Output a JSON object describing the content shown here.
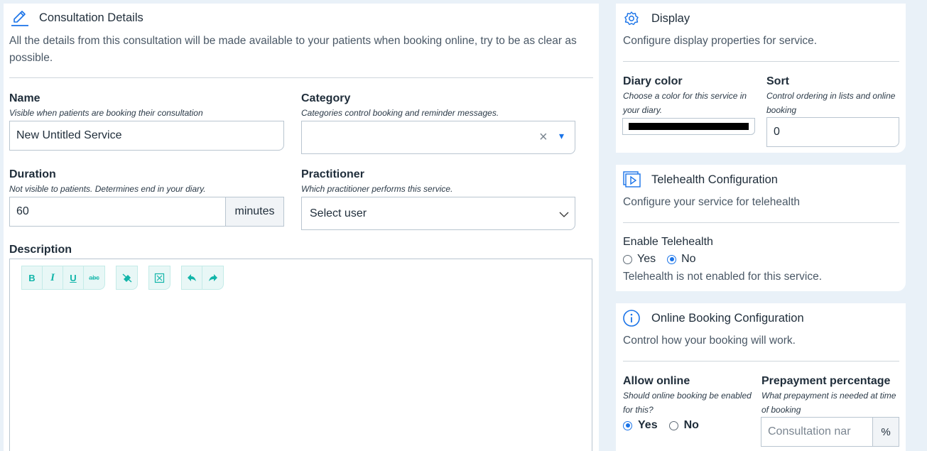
{
  "consultation": {
    "title": "Consultation Details",
    "description": "All the details from this consultation will be made available to your patients when booking online, try to be as clear as possible.",
    "name_label": "Name",
    "name_hint": "Visible when patients are booking their consultation",
    "name_value": "New Untitled Service",
    "category_label": "Category",
    "category_hint": "Categories control booking and reminder messages.",
    "category_clear": "×",
    "category_caret": "▾",
    "duration_label": "Duration",
    "duration_hint": "Not visible to patients. Determines end in your diary.",
    "duration_value": "60",
    "duration_unit": "minutes",
    "practitioner_label": "Practitioner",
    "practitioner_hint": "Which practitioner performs this service.",
    "practitioner_value": "Select user",
    "description_label": "Description",
    "toolbar": {
      "bold": "B",
      "italic": "I",
      "underline": "U",
      "strike": "abc"
    }
  },
  "display": {
    "title": "Display",
    "description": "Configure display properties for service.",
    "diary_color_label": "Diary color",
    "diary_color_hint": "Choose a color for this service in your diary.",
    "diary_color_value": "#000000",
    "sort_label": "Sort",
    "sort_hint": "Control ordering in lists and online booking",
    "sort_value": "0"
  },
  "telehealth": {
    "title": "Telehealth Configuration",
    "description": "Configure your service for telehealth",
    "enable_label": "Enable Telehealth",
    "yes_label": "Yes",
    "no_label": "No",
    "selected": "No",
    "status": "Telehealth is not enabled for this service."
  },
  "online_booking": {
    "title": "Online Booking Configuration",
    "description": "Control how your booking will work.",
    "allow_label": "Allow online",
    "allow_hint": "Should online booking be enabled for this?",
    "yes_label": "Yes",
    "no_label": "No",
    "selected": "Yes",
    "prepayment_label": "Prepayment percentage",
    "prepayment_hint": "What prepayment is needed at time of booking",
    "prepayment_placeholder": "Consultation nar",
    "percent_unit": "%"
  },
  "colors": {
    "accent_blue": "#1a73e8",
    "editor_accent": "#12b5a9"
  }
}
